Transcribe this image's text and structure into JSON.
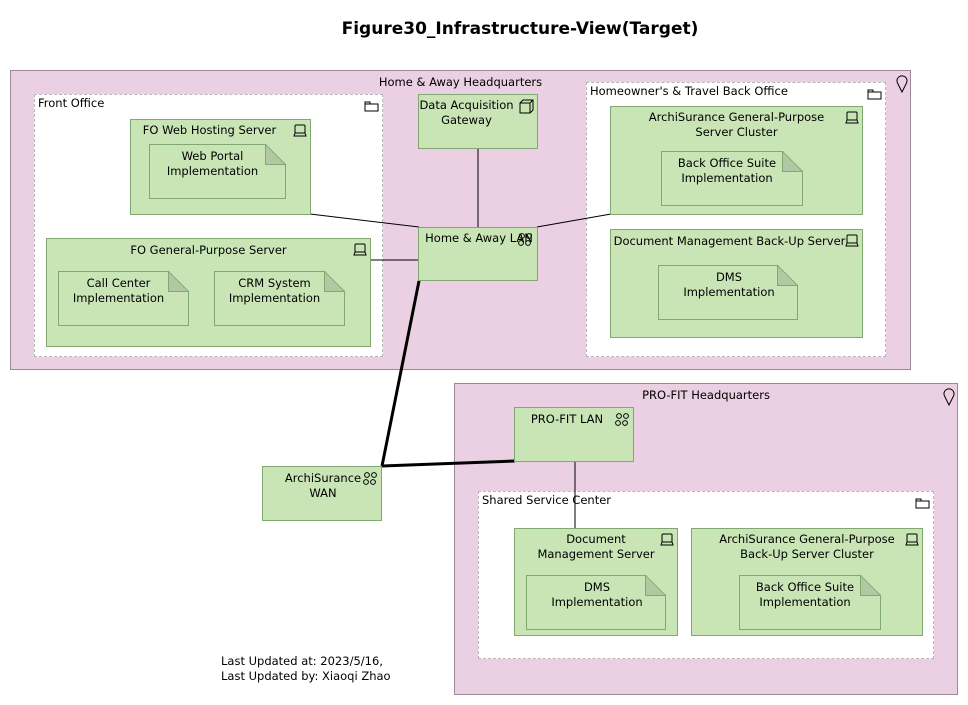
{
  "title": "Figure30_Infrastructure-View(Target)",
  "locations": {
    "home_away_hq": "Home & Away Headquarters",
    "profit_hq": "PRO-FIT Headquarters"
  },
  "groups": {
    "front_office": "Front Office",
    "back_office": "Homeowner's & Travel Back Office",
    "shared_service": "Shared Service Center"
  },
  "nodes": {
    "fo_web": "FO Web Hosting Server",
    "fo_gp": "FO General-Purpose Server",
    "gateway": "Data Acquisition Gateway",
    "ha_lan": "Home & Away LAN",
    "gp_cluster": "ArchiSurance General-Purpose Server Cluster",
    "dm_backup": "Document Management Back-Up Server",
    "profit_lan": "PRO-FIT LAN",
    "wan": "ArchiSurance WAN",
    "dm_server": "Document Management Server",
    "gp_backup_cluster": "ArchiSurance General-Purpose Back-Up Server Cluster"
  },
  "artifacts": {
    "web_portal": "Web Portal Implementation",
    "call_center": "Call Center Implementation",
    "crm": "CRM System Implementation",
    "back_office_suite": "Back Office Suite Implementation",
    "dms_backup": "DMS Implementation",
    "dms": "DMS Implementation",
    "back_office_suite_backup": "Back Office Suite Implementation"
  },
  "footer": {
    "updated_at": "Last Updated at: 2023/5/16,",
    "updated_by": "Last Updated by: Xiaoqi Zhao"
  }
}
